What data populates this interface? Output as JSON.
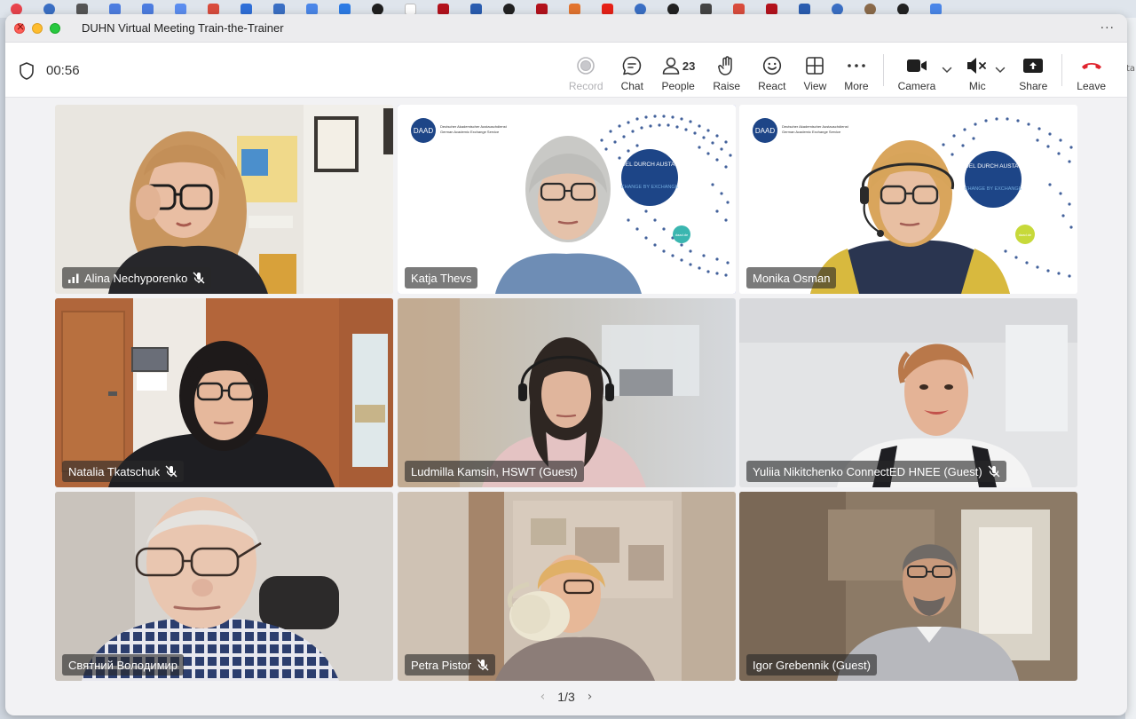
{
  "window": {
    "title": "DUHN Virtual Meeting Train-the-Trainer",
    "menu_icon": "ellipsis-icon"
  },
  "side_peek": "ta",
  "toolbar": {
    "timer": "00:56",
    "record_label": "Record",
    "chat_label": "Chat",
    "people_label": "People",
    "people_count": "23",
    "raise_label": "Raise",
    "react_label": "React",
    "view_label": "View",
    "more_label": "More",
    "camera_label": "Camera",
    "mic_label": "Mic",
    "share_label": "Share",
    "leave_label": "Leave"
  },
  "participants": [
    {
      "name": "Alina Nechyporenko",
      "muted": true,
      "signal": true,
      "active": false
    },
    {
      "name": "Katja Thevs",
      "muted": false,
      "signal": false,
      "active": true
    },
    {
      "name": "Monika Osman",
      "muted": false,
      "signal": false,
      "active": false
    },
    {
      "name": "Natalia Tkatschuk",
      "muted": true,
      "signal": false,
      "active": false
    },
    {
      "name": "Ludmilla Kamsin, HSWT (Guest)",
      "muted": false,
      "signal": false,
      "active": false
    },
    {
      "name": "Yuliia Nikitchenko ConnectED HNEE (Guest)",
      "muted": true,
      "signal": false,
      "active": false
    },
    {
      "name": "Святний Володимир",
      "muted": false,
      "signal": false,
      "active": false
    },
    {
      "name": "Petra Pistor",
      "muted": true,
      "signal": false,
      "active": false
    },
    {
      "name": "Igor Grebennik (Guest)",
      "muted": false,
      "signal": false,
      "active": false
    }
  ],
  "slide": {
    "logo": "DAAD",
    "line1": "Deutscher Akademischer Austauschdienst",
    "line2": "German Academic Exchange Service",
    "circle_top": "WANDEL DURCH AUSTAUSCH",
    "circle_bottom": "CHANGE BY EXCHANGE",
    "badge": "daad.de"
  },
  "pager": {
    "page": "1/3"
  },
  "colors": {
    "active_border": "#5b6dd6",
    "leave_red": "#e0242e",
    "daad_blue": "#1d4587"
  }
}
